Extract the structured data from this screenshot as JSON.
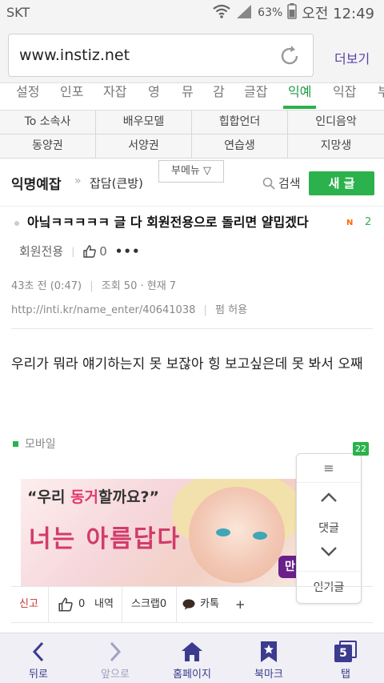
{
  "status_bar": {
    "carrier": "SKT",
    "battery": "63%",
    "time": "오전 12:49"
  },
  "browser": {
    "url": "www.instiz.net",
    "more_label": "더보기"
  },
  "categories": [
    "설정",
    "인포",
    "자잡",
    "영",
    "뮤",
    "감",
    "글잡",
    "익예",
    "익잡",
    "부"
  ],
  "active_category": "익예",
  "subnav": {
    "row1": [
      "To 소속사",
      "배우모델",
      "힙합언더",
      "인디음악"
    ],
    "row2": [
      "동양권",
      "서양권",
      "연습생",
      "지망생"
    ]
  },
  "board": {
    "title": "익명예잡",
    "separator": "»",
    "subtitle": "잡담(큰방)",
    "submenu_label": "부메뉴 ▽",
    "search_label": "검색",
    "write_label": "새 글"
  },
  "post": {
    "title": "아닠ㅋㅋㅋㅋㅋ 글 다 회원전용으로 돌리면 얄밉겠다",
    "new_badge": "N",
    "comment_count": "2",
    "membership": "회원전용",
    "likes": "0",
    "time_info": "43초 전 (0:47)",
    "view_info": "조회 50 · 현재 7",
    "short_url": "http://inti.kr/name_enter/40641038",
    "share_label": "펌 허용",
    "body": "우리가 뭐라 얘기하는지 못 보잖아 힝 보고싶은데 못 봐서 오째",
    "device": "모바일"
  },
  "banner": {
    "line1_pre": "“우리 ",
    "line1_hl": "동거",
    "line1_post": "할까요?”",
    "line2": "너는 아름답다",
    "tag": "만"
  },
  "float_panel": {
    "badge": "22",
    "menu_icon": "≡",
    "comments_label": "댓글",
    "popular_label": "인기글"
  },
  "actions": {
    "report": "신고",
    "likes": "0",
    "history": "내역",
    "scrap": "스크랩0",
    "katalk": "카톡",
    "plus": "+"
  },
  "bottom_nav": {
    "back": "뒤로",
    "forward": "앞으로",
    "home": "홈페이지",
    "bookmark": "북마크",
    "tabs": "탭",
    "tab_count": "5"
  },
  "colors": {
    "accent_green": "#2bb24c",
    "nav_blue": "#3b3b8f",
    "more_purple": "#5a3fa8",
    "report_red": "#c0392b"
  }
}
